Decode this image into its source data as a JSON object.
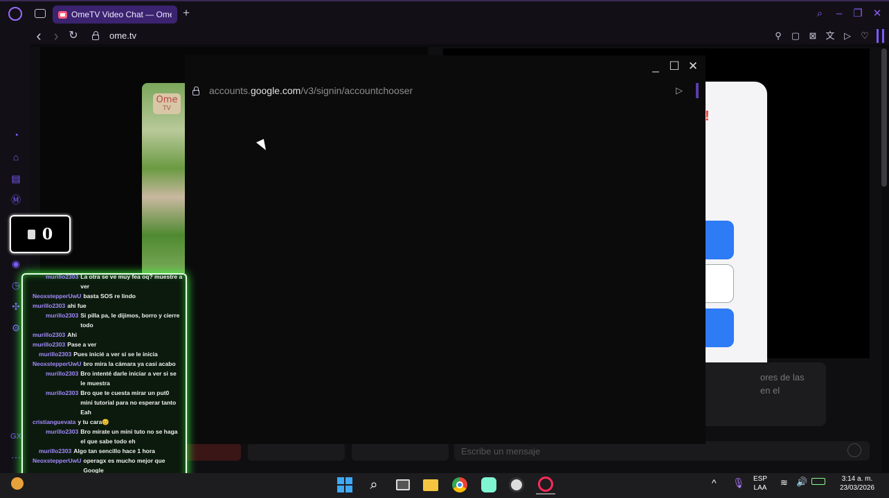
{
  "browser": {
    "tab_title": "OmeTV Video Chat — Ome",
    "new_tab": "+",
    "url": "ome.tv",
    "nav": {
      "back": "‹",
      "forward": "›",
      "reload": "↻"
    },
    "window_controls": {
      "search": "⌕",
      "minimize": "–",
      "maximize": "❐",
      "close": "✕"
    },
    "toolbar_icons": [
      "pin-icon",
      "snapshot-icon",
      "block-icon",
      "translate-icon",
      "send-icon",
      "heart-icon"
    ]
  },
  "popup": {
    "url_prefix": "accounts.",
    "url_domain": "google.com",
    "url_path": "/v3/signin/accountchooser",
    "controls": {
      "minimize": "_",
      "maximize": "☐",
      "close": "✕"
    },
    "send_icon": "▷"
  },
  "page": {
    "logo_line1": "Ome",
    "logo_line2": "TV",
    "exclamation": "!",
    "info_text_line1": "ores de las",
    "info_text_line2": "en el",
    "message_placeholder": "Escribe un mensaje"
  },
  "viewers": {
    "count": "0"
  },
  "chat": {
    "messages": [
      {
        "user": "murillo2303",
        "text": "La otra se ve muy fea oq? muestre a ver",
        "indent": 1
      },
      {
        "user": "NeoxstepperUwU",
        "text": "basta SOS re lindo",
        "indent": 0
      },
      {
        "user": "murillo2303",
        "text": "ahi fue",
        "indent": 0
      },
      {
        "user": "murillo2303",
        "text": "Si pilla pa, le dijimos, borro y cierre todo",
        "indent": 1
      },
      {
        "user": "murillo2303",
        "text": "Ahi",
        "indent": 0
      },
      {
        "user": "murillo2303",
        "text": "Pase a ver",
        "indent": 0
      },
      {
        "user": "murillo2303",
        "text": "Pues inicié a ver si se le inicia",
        "indent": 2
      },
      {
        "user": "NeoxstepperUwU",
        "text": "bro mira la cámara ya casi acabo",
        "indent": 0
      },
      {
        "user": "murillo2303",
        "text": "Bro intenté darle iniciar a ver si se le muestra",
        "indent": 1
      },
      {
        "user": "murillo2303",
        "text": "Bro que te cuesta mirar un put0 mini tutorial para no esperar tanto Eah",
        "indent": 1
      },
      {
        "user": "cristianguevata",
        "text": "y tu cara😊",
        "indent": 0
      },
      {
        "user": "murillo2303",
        "text": "Bro mírate un mini tuto no se haga el que sabe todo eh",
        "indent": 1
      },
      {
        "user": "murillo2303",
        "text": "Algo tan sencillo hace 1 hora",
        "indent": 2
      },
      {
        "user": "NeoxstepperUwU",
        "text": "operagx es mucho mejor que Google",
        "indent": 0
      }
    ]
  },
  "taskbar": {
    "lang_line1": "ESP",
    "lang_line2": "LAA",
    "time": "3:14 a. m.",
    "date": "23/03/2026",
    "caret": "^"
  },
  "colors": {
    "accent": "#8b5cf6",
    "chat_glow": "#39ff3a",
    "blue_button": "#2d7bf5"
  }
}
